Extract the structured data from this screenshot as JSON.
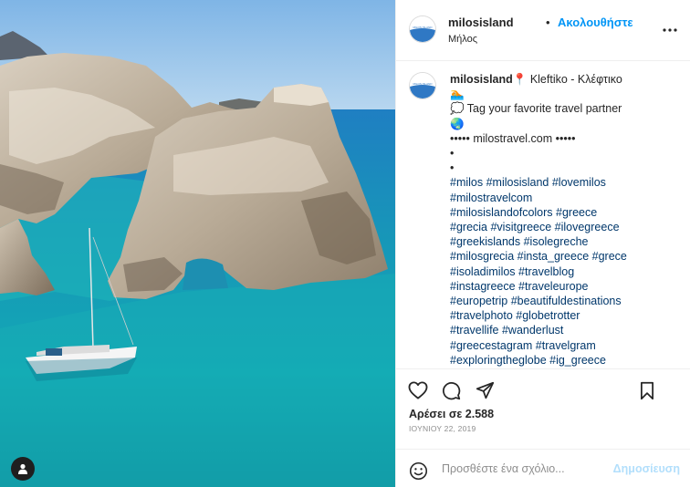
{
  "post": {
    "username": "milosisland",
    "separator": "•",
    "follow_label": "Ακολουθήστε",
    "location": "Μήλος",
    "likes_text": "Αρέσει σε 2.588",
    "date": "ΙΟΥΝΙΟΥ 22, 2019"
  },
  "caption": {
    "username": "milosisland",
    "line1": "📍 Kleftiko - Κλέφτικο",
    "line2": "🏊",
    "line3": "💭 Tag your favorite travel partner",
    "line4": "🌏",
    "line5": "••••• milostravel.com •••••",
    "line6": "•",
    "line7": "•",
    "hashtag_lines": [
      "#milos #milosisland #lovemilos",
      "#milostravelcom",
      "#milosislandofcolors #greece",
      "#grecia #visitgreece #ilovegreece",
      "#greekislands #isolegreche",
      "#milosgrecia #insta_greece #grece",
      "#isoladimilos #travelblog",
      "#instagreece #traveleurope",
      "#europetrip #beautifuldestinations",
      "#travelphoto #globetrotter",
      "#travellife #wanderlust",
      "#greecestagram #travelgram",
      "#exploringtheglobe #ig_greece"
    ]
  },
  "comment_box": {
    "placeholder": "Προσθέστε ένα σχόλιο...",
    "post_label": "Δημοσίευση"
  },
  "icons": {
    "more": "more-options-icon",
    "like": "heart-icon",
    "comment": "comment-icon",
    "share": "share-icon",
    "save": "bookmark-icon",
    "emoji": "emoji-icon",
    "tagged": "user-tag-icon"
  },
  "colors": {
    "accent": "#0095f6",
    "hashtag": "#00376b",
    "post_disabled": "#b2dffc",
    "muted": "#8e8e8e"
  }
}
